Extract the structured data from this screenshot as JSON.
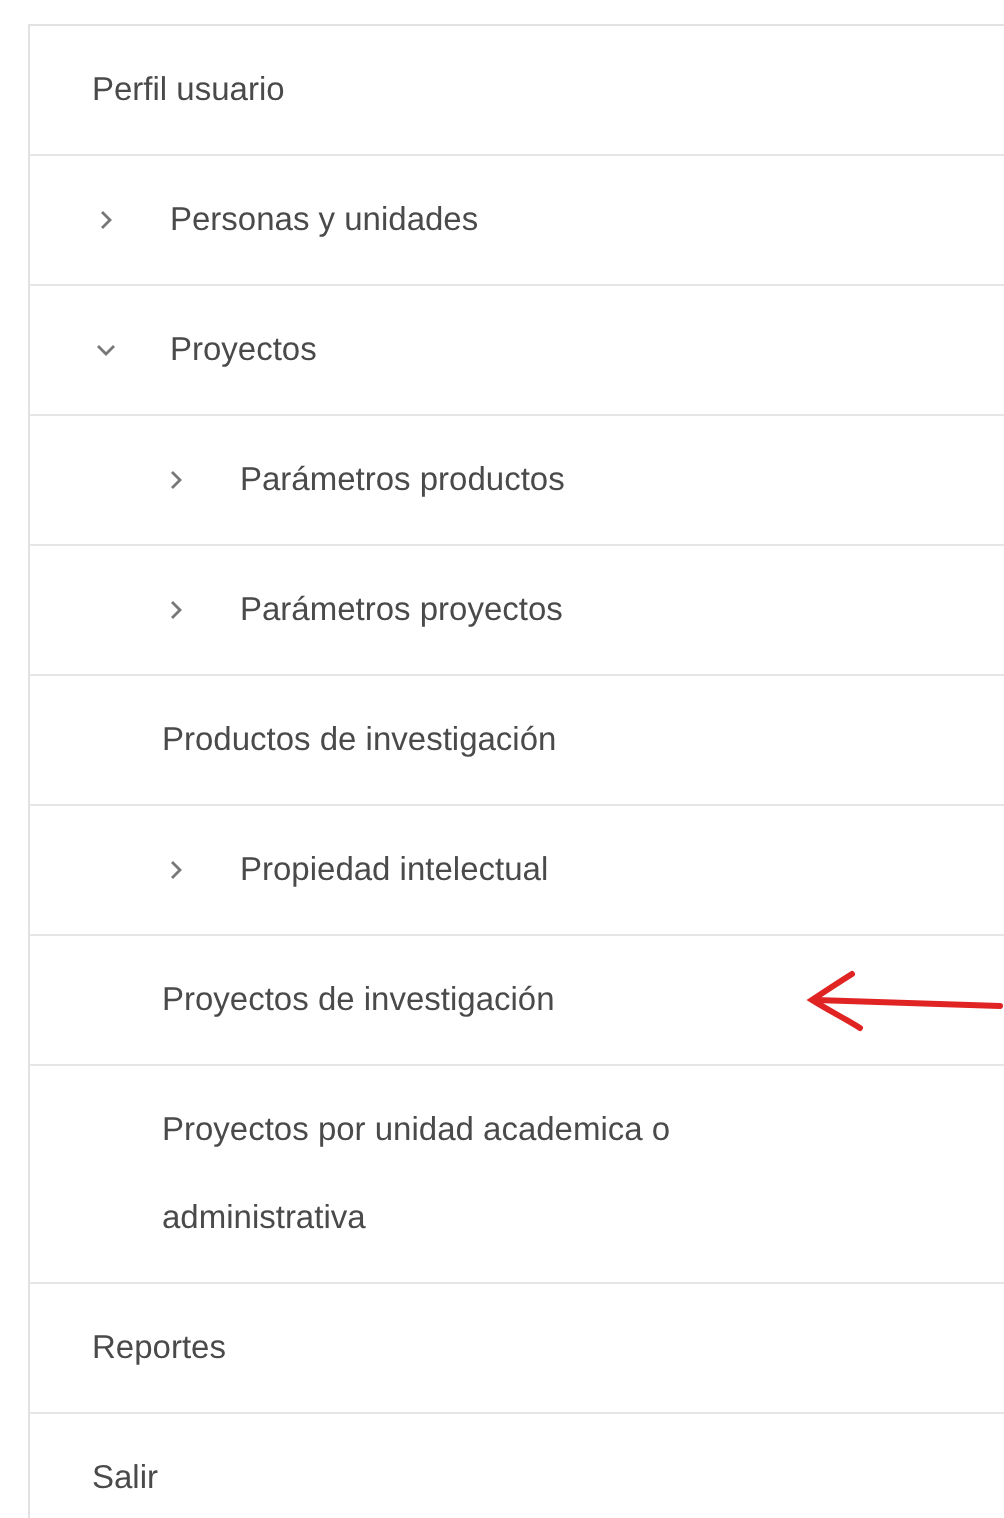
{
  "menu": [
    {
      "label": "Perfil usuario",
      "annotated": false
    },
    {
      "label": "Personas y unidades",
      "expanded": false,
      "annotated": false
    },
    {
      "label": "Proyectos",
      "expanded": true,
      "annotated": false,
      "children": [
        {
          "label": "Parámetros productos",
          "expanded": false,
          "annotated": false
        },
        {
          "label": "Parámetros proyectos",
          "expanded": false,
          "annotated": false
        },
        {
          "label": "Productos de investigación",
          "annotated": false
        },
        {
          "label": "Propiedad intelectual",
          "expanded": false,
          "annotated": false
        },
        {
          "label": "Proyectos de investigación",
          "annotated": true
        },
        {
          "label": "Proyectos por unidad academica o administrativa",
          "annotated": false
        }
      ]
    },
    {
      "label": "Reportes",
      "annotated": false
    },
    {
      "label": "Salir",
      "annotated": false
    }
  ]
}
